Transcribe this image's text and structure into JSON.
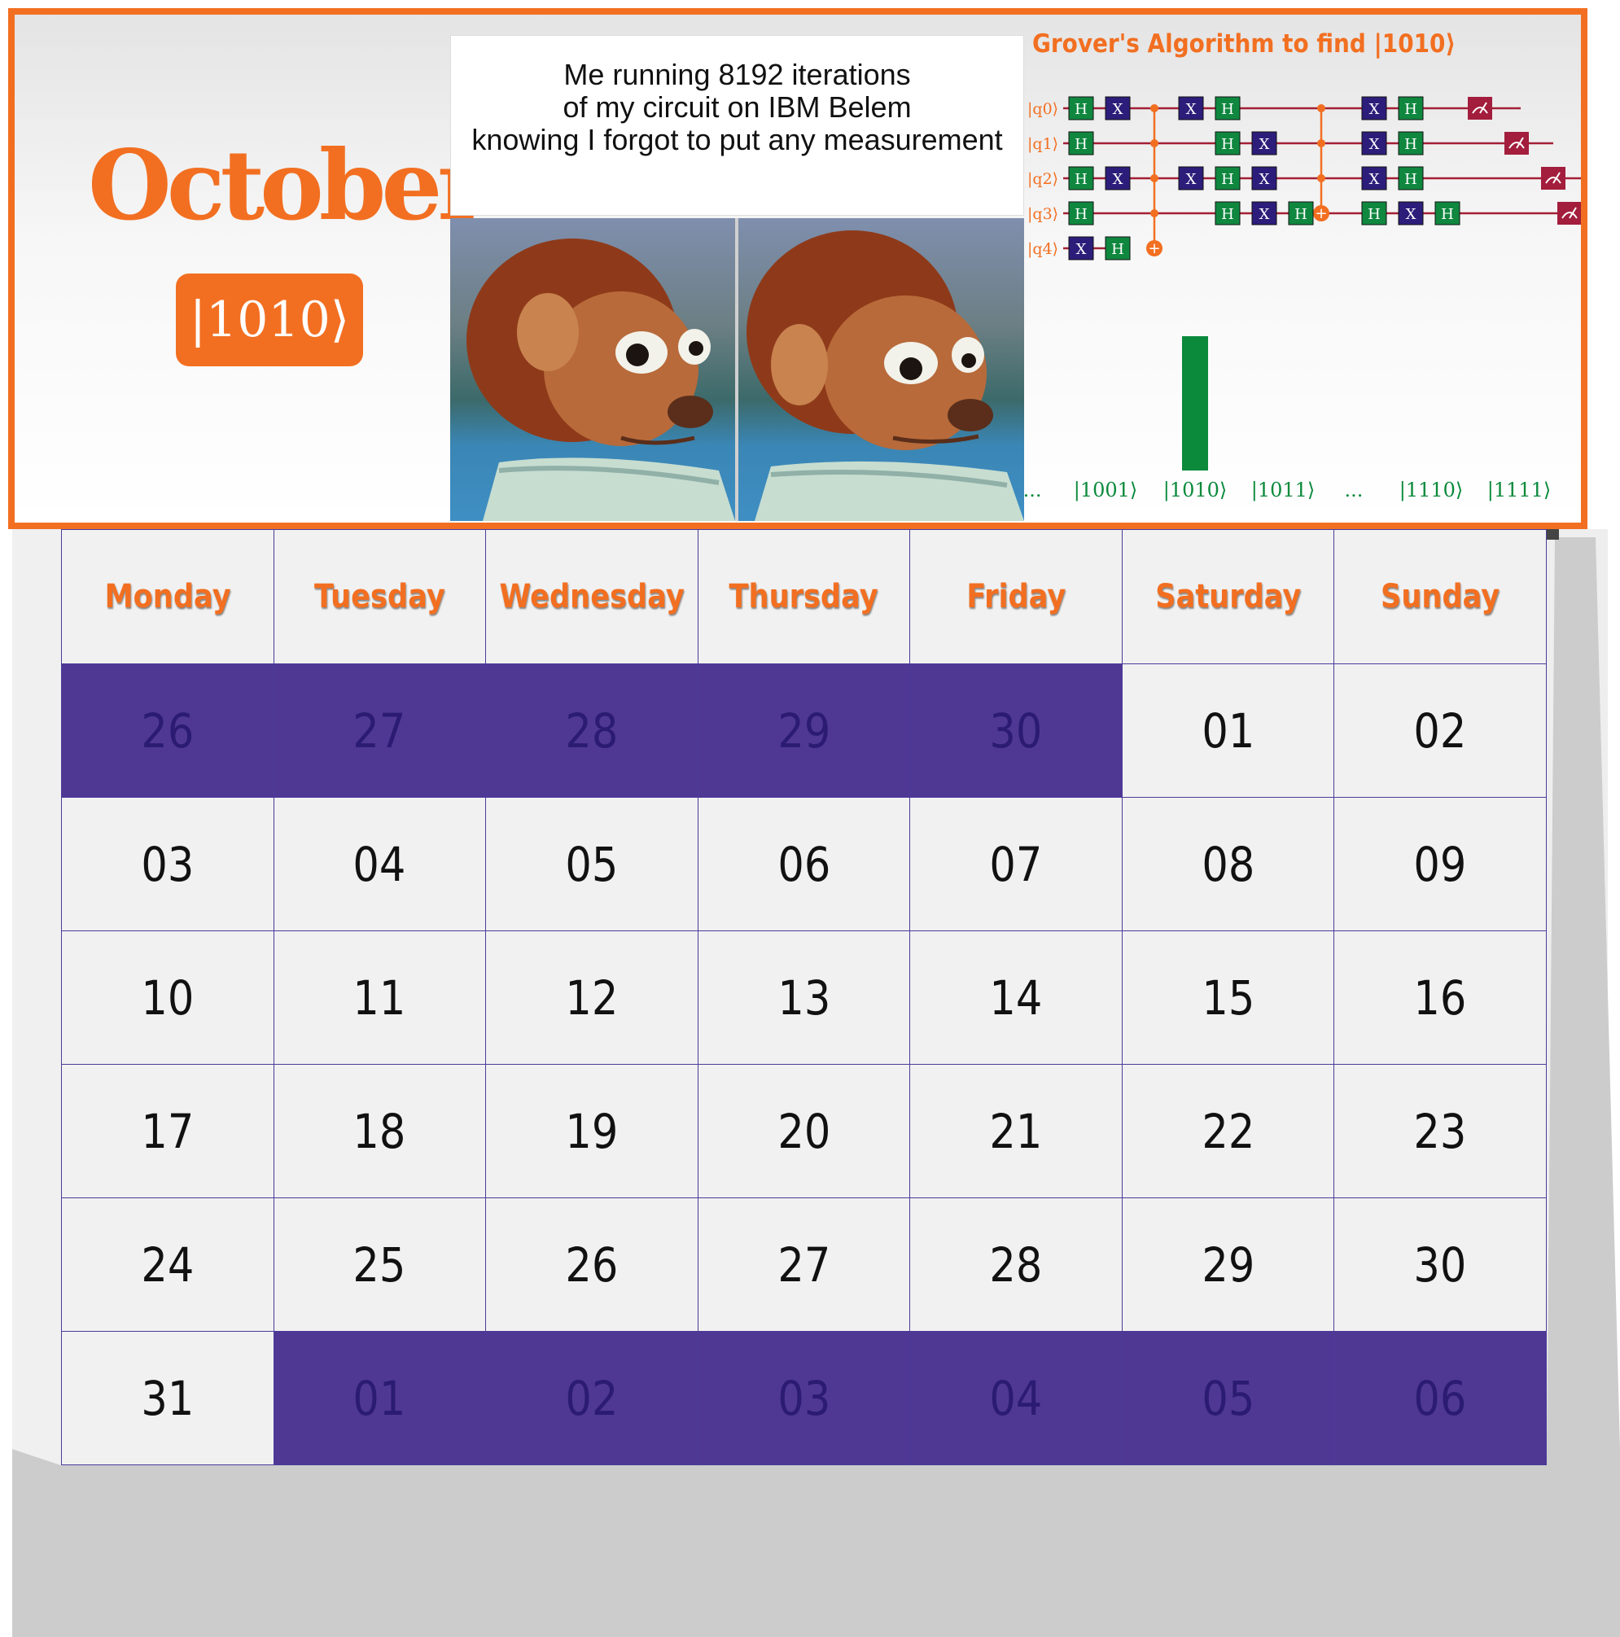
{
  "calendar": {
    "month": "October",
    "ket_badge": "|1010⟩",
    "weekdays": [
      "Monday",
      "Tuesday",
      "Wednesday",
      "Thursday",
      "Friday",
      "Saturday",
      "Sunday"
    ],
    "weeks": [
      [
        {
          "day": "26",
          "outside": true
        },
        {
          "day": "27",
          "outside": true
        },
        {
          "day": "28",
          "outside": true
        },
        {
          "day": "29",
          "outside": true
        },
        {
          "day": "30",
          "outside": true
        },
        {
          "day": "01",
          "outside": false
        },
        {
          "day": "02",
          "outside": false
        }
      ],
      [
        {
          "day": "03",
          "outside": false
        },
        {
          "day": "04",
          "outside": false
        },
        {
          "day": "05",
          "outside": false
        },
        {
          "day": "06",
          "outside": false
        },
        {
          "day": "07",
          "outside": false
        },
        {
          "day": "08",
          "outside": false
        },
        {
          "day": "09",
          "outside": false
        }
      ],
      [
        {
          "day": "10",
          "outside": false
        },
        {
          "day": "11",
          "outside": false
        },
        {
          "day": "12",
          "outside": false
        },
        {
          "day": "13",
          "outside": false
        },
        {
          "day": "14",
          "outside": false
        },
        {
          "day": "15",
          "outside": false
        },
        {
          "day": "16",
          "outside": false
        }
      ],
      [
        {
          "day": "17",
          "outside": false
        },
        {
          "day": "18",
          "outside": false
        },
        {
          "day": "19",
          "outside": false
        },
        {
          "day": "20",
          "outside": false
        },
        {
          "day": "21",
          "outside": false
        },
        {
          "day": "22",
          "outside": false
        },
        {
          "day": "23",
          "outside": false
        }
      ],
      [
        {
          "day": "24",
          "outside": false
        },
        {
          "day": "25",
          "outside": false
        },
        {
          "day": "26",
          "outside": false
        },
        {
          "day": "27",
          "outside": false
        },
        {
          "day": "28",
          "outside": false
        },
        {
          "day": "29",
          "outside": false
        },
        {
          "day": "30",
          "outside": false
        }
      ],
      [
        {
          "day": "31",
          "outside": false
        },
        {
          "day": "01",
          "outside": true
        },
        {
          "day": "02",
          "outside": true
        },
        {
          "day": "03",
          "outside": true
        },
        {
          "day": "04",
          "outside": true
        },
        {
          "day": "05",
          "outside": true
        },
        {
          "day": "06",
          "outside": true
        }
      ]
    ]
  },
  "meme": {
    "caption_lines": [
      "Me running 8192 iterations",
      "of my circuit on IBM Belem",
      "knowing I forgot to put any measurement"
    ],
    "image_subject": "puppet-monkey-side-eye"
  },
  "circuit": {
    "title": "Grover's Algorithm to find |1010⟩",
    "qubits": [
      "|q0⟩",
      "|q1⟩",
      "|q2⟩",
      "|q3⟩",
      "|q4⟩"
    ],
    "gate_labels": {
      "hadamard": "H",
      "pauli_x": "X",
      "target": "+"
    }
  },
  "histogram": {
    "labels": [
      "...",
      "|1001⟩",
      "|1010⟩",
      "|1011⟩",
      "...",
      "|1110⟩",
      "|1111⟩"
    ],
    "values": [
      0,
      0,
      1,
      0,
      0,
      0,
      0
    ]
  },
  "colors": {
    "accent": "#f26f21",
    "calendar_outside_bg": "#4f3894",
    "calendar_outside_text": "#2c1b72",
    "gate_h": "#10873f",
    "gate_x": "#2d1d7a",
    "wire": "#a32035",
    "measure": "#a31d3c",
    "histogram_bar": "#0b8a3c"
  }
}
